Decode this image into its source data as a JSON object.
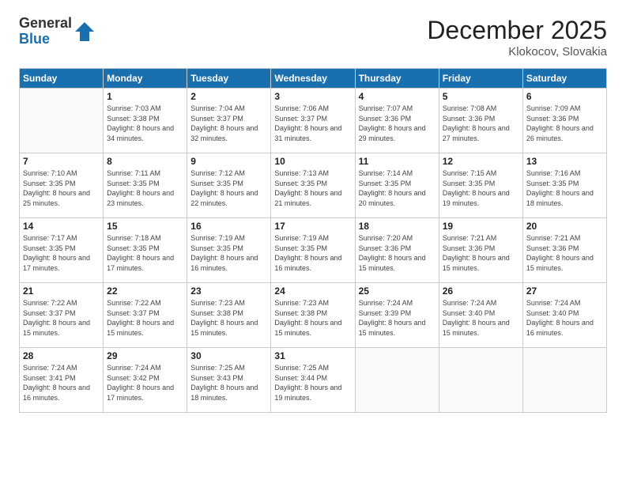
{
  "header": {
    "logo_general": "General",
    "logo_blue": "Blue",
    "month_title": "December 2025",
    "location": "Klokocov, Slovakia"
  },
  "days_of_week": [
    "Sunday",
    "Monday",
    "Tuesday",
    "Wednesday",
    "Thursday",
    "Friday",
    "Saturday"
  ],
  "weeks": [
    [
      {
        "day": "",
        "sunrise": "",
        "sunset": "",
        "daylight": ""
      },
      {
        "day": "1",
        "sunrise": "Sunrise: 7:03 AM",
        "sunset": "Sunset: 3:38 PM",
        "daylight": "Daylight: 8 hours and 34 minutes."
      },
      {
        "day": "2",
        "sunrise": "Sunrise: 7:04 AM",
        "sunset": "Sunset: 3:37 PM",
        "daylight": "Daylight: 8 hours and 32 minutes."
      },
      {
        "day": "3",
        "sunrise": "Sunrise: 7:06 AM",
        "sunset": "Sunset: 3:37 PM",
        "daylight": "Daylight: 8 hours and 31 minutes."
      },
      {
        "day": "4",
        "sunrise": "Sunrise: 7:07 AM",
        "sunset": "Sunset: 3:36 PM",
        "daylight": "Daylight: 8 hours and 29 minutes."
      },
      {
        "day": "5",
        "sunrise": "Sunrise: 7:08 AM",
        "sunset": "Sunset: 3:36 PM",
        "daylight": "Daylight: 8 hours and 27 minutes."
      },
      {
        "day": "6",
        "sunrise": "Sunrise: 7:09 AM",
        "sunset": "Sunset: 3:36 PM",
        "daylight": "Daylight: 8 hours and 26 minutes."
      }
    ],
    [
      {
        "day": "7",
        "sunrise": "Sunrise: 7:10 AM",
        "sunset": "Sunset: 3:35 PM",
        "daylight": "Daylight: 8 hours and 25 minutes."
      },
      {
        "day": "8",
        "sunrise": "Sunrise: 7:11 AM",
        "sunset": "Sunset: 3:35 PM",
        "daylight": "Daylight: 8 hours and 23 minutes."
      },
      {
        "day": "9",
        "sunrise": "Sunrise: 7:12 AM",
        "sunset": "Sunset: 3:35 PM",
        "daylight": "Daylight: 8 hours and 22 minutes."
      },
      {
        "day": "10",
        "sunrise": "Sunrise: 7:13 AM",
        "sunset": "Sunset: 3:35 PM",
        "daylight": "Daylight: 8 hours and 21 minutes."
      },
      {
        "day": "11",
        "sunrise": "Sunrise: 7:14 AM",
        "sunset": "Sunset: 3:35 PM",
        "daylight": "Daylight: 8 hours and 20 minutes."
      },
      {
        "day": "12",
        "sunrise": "Sunrise: 7:15 AM",
        "sunset": "Sunset: 3:35 PM",
        "daylight": "Daylight: 8 hours and 19 minutes."
      },
      {
        "day": "13",
        "sunrise": "Sunrise: 7:16 AM",
        "sunset": "Sunset: 3:35 PM",
        "daylight": "Daylight: 8 hours and 18 minutes."
      }
    ],
    [
      {
        "day": "14",
        "sunrise": "Sunrise: 7:17 AM",
        "sunset": "Sunset: 3:35 PM",
        "daylight": "Daylight: 8 hours and 17 minutes."
      },
      {
        "day": "15",
        "sunrise": "Sunrise: 7:18 AM",
        "sunset": "Sunset: 3:35 PM",
        "daylight": "Daylight: 8 hours and 17 minutes."
      },
      {
        "day": "16",
        "sunrise": "Sunrise: 7:19 AM",
        "sunset": "Sunset: 3:35 PM",
        "daylight": "Daylight: 8 hours and 16 minutes."
      },
      {
        "day": "17",
        "sunrise": "Sunrise: 7:19 AM",
        "sunset": "Sunset: 3:35 PM",
        "daylight": "Daylight: 8 hours and 16 minutes."
      },
      {
        "day": "18",
        "sunrise": "Sunrise: 7:20 AM",
        "sunset": "Sunset: 3:36 PM",
        "daylight": "Daylight: 8 hours and 15 minutes."
      },
      {
        "day": "19",
        "sunrise": "Sunrise: 7:21 AM",
        "sunset": "Sunset: 3:36 PM",
        "daylight": "Daylight: 8 hours and 15 minutes."
      },
      {
        "day": "20",
        "sunrise": "Sunrise: 7:21 AM",
        "sunset": "Sunset: 3:36 PM",
        "daylight": "Daylight: 8 hours and 15 minutes."
      }
    ],
    [
      {
        "day": "21",
        "sunrise": "Sunrise: 7:22 AM",
        "sunset": "Sunset: 3:37 PM",
        "daylight": "Daylight: 8 hours and 15 minutes."
      },
      {
        "day": "22",
        "sunrise": "Sunrise: 7:22 AM",
        "sunset": "Sunset: 3:37 PM",
        "daylight": "Daylight: 8 hours and 15 minutes."
      },
      {
        "day": "23",
        "sunrise": "Sunrise: 7:23 AM",
        "sunset": "Sunset: 3:38 PM",
        "daylight": "Daylight: 8 hours and 15 minutes."
      },
      {
        "day": "24",
        "sunrise": "Sunrise: 7:23 AM",
        "sunset": "Sunset: 3:38 PM",
        "daylight": "Daylight: 8 hours and 15 minutes."
      },
      {
        "day": "25",
        "sunrise": "Sunrise: 7:24 AM",
        "sunset": "Sunset: 3:39 PM",
        "daylight": "Daylight: 8 hours and 15 minutes."
      },
      {
        "day": "26",
        "sunrise": "Sunrise: 7:24 AM",
        "sunset": "Sunset: 3:40 PM",
        "daylight": "Daylight: 8 hours and 15 minutes."
      },
      {
        "day": "27",
        "sunrise": "Sunrise: 7:24 AM",
        "sunset": "Sunset: 3:40 PM",
        "daylight": "Daylight: 8 hours and 16 minutes."
      }
    ],
    [
      {
        "day": "28",
        "sunrise": "Sunrise: 7:24 AM",
        "sunset": "Sunset: 3:41 PM",
        "daylight": "Daylight: 8 hours and 16 minutes."
      },
      {
        "day": "29",
        "sunrise": "Sunrise: 7:24 AM",
        "sunset": "Sunset: 3:42 PM",
        "daylight": "Daylight: 8 hours and 17 minutes."
      },
      {
        "day": "30",
        "sunrise": "Sunrise: 7:25 AM",
        "sunset": "Sunset: 3:43 PM",
        "daylight": "Daylight: 8 hours and 18 minutes."
      },
      {
        "day": "31",
        "sunrise": "Sunrise: 7:25 AM",
        "sunset": "Sunset: 3:44 PM",
        "daylight": "Daylight: 8 hours and 19 minutes."
      },
      {
        "day": "",
        "sunrise": "",
        "sunset": "",
        "daylight": ""
      },
      {
        "day": "",
        "sunrise": "",
        "sunset": "",
        "daylight": ""
      },
      {
        "day": "",
        "sunrise": "",
        "sunset": "",
        "daylight": ""
      }
    ]
  ]
}
